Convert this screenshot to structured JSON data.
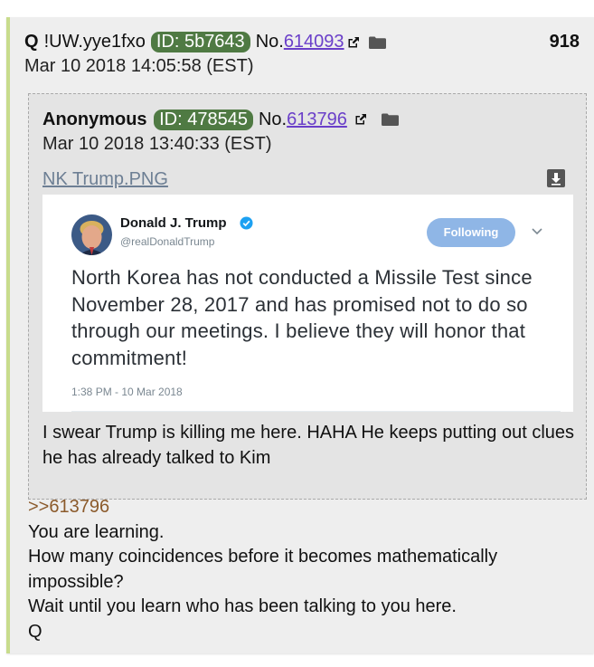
{
  "colors": {
    "id_badge_bg": "#4f7a43",
    "link": "#6a3fc9",
    "quotelink": "#8b5a2b",
    "post_bg": "#eeeeee",
    "quote_bg": "#e4e4e4"
  },
  "post": {
    "name": "Q",
    "tripcode": "!UW.yye1fxo",
    "id_badge": "ID: 5b7643",
    "no_prefix": "No.",
    "number": "614093",
    "reply_count": "918",
    "timestamp": "Mar 10 2018 14:05:58 (EST)",
    "body": {
      "quotelink": ">>613796",
      "lines": [
        "You are learning.",
        "How many coincidences before it becomes mathematically impossible?",
        "Wait until you learn who has been talking to you here.",
        "Q"
      ]
    }
  },
  "quoted_post": {
    "name": "Anonymous",
    "id_badge": "ID: 478545",
    "no_prefix": "No.",
    "number": "613796",
    "timestamp": "Mar 10 2018 13:40:33 (EST)",
    "file_name": "NK Trump.PNG",
    "body": "I swear Trump is killing me here. HAHA He keeps putting out clues he has already talked to Kim",
    "tweet": {
      "display_name": "Donald J. Trump",
      "handle": "@realDonaldTrump",
      "follow_label": "Following",
      "text": "North Korea has not conducted a Missile Test since November 28, 2017 and has promised not to do so through our meetings. I believe they will honor that commitment!",
      "time": "1:38 PM - 10 Mar 2018"
    }
  },
  "icons": {
    "external_link": "external-link-icon",
    "folder": "folder-icon",
    "download": "download-icon",
    "verified": "verified-icon",
    "chevron": "chevron-down-icon"
  }
}
